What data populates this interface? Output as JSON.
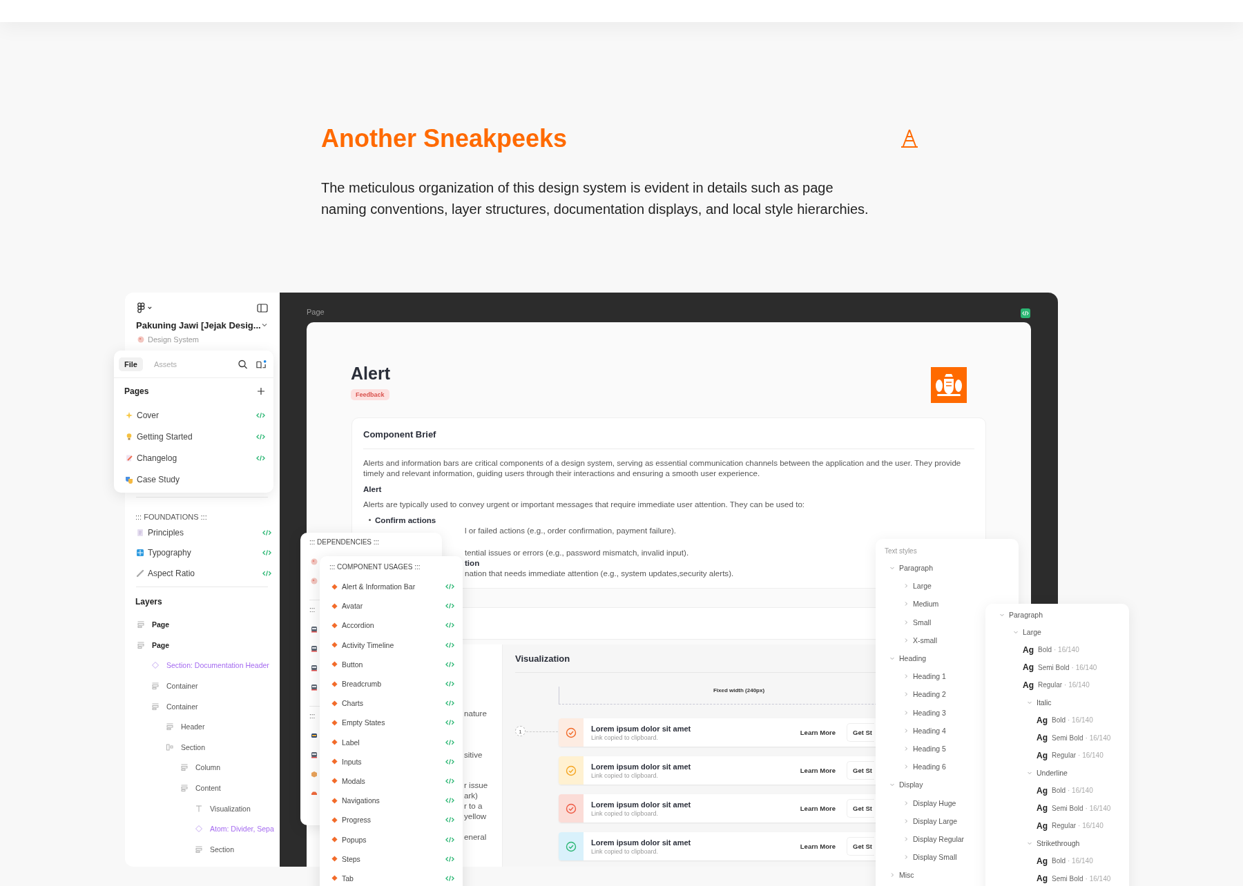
{
  "header": {
    "title": "Another Sneakpeeks",
    "description": "The meticulous organization of this design system is evident in details such as page naming conventions, layer structures, documentation displays, and local style hierarchies."
  },
  "sidebar": {
    "file_name": "Pakuning Jawi [Jejak Desig...",
    "project": "Design System",
    "foundations_title": "::: FOUNDATIONS :::",
    "foundations": [
      {
        "label": "Principles"
      },
      {
        "label": "Typography"
      },
      {
        "label": "Aspect Ratio"
      }
    ],
    "layers_title": "Layers",
    "layers": [
      {
        "label": "Page",
        "kind": "frame"
      },
      {
        "label": "Page",
        "kind": "frame",
        "children": [
          {
            "label": "Section: Documentation Header",
            "kind": "component"
          },
          {
            "label": "Container",
            "kind": "frame"
          },
          {
            "label": "Container",
            "kind": "frame",
            "children": [
              {
                "label": "Header",
                "kind": "frame"
              },
              {
                "label": "Section",
                "kind": "columns",
                "children": [
                  {
                    "label": "Column",
                    "kind": "frame"
                  },
                  {
                    "label": "Content",
                    "kind": "frame",
                    "children": [
                      {
                        "label": "Visualization",
                        "kind": "text"
                      },
                      {
                        "label": "Atom: Divider, Sepa",
                        "kind": "component"
                      },
                      {
                        "label": "Section",
                        "kind": "frame"
                      }
                    ]
                  }
                ]
              }
            ]
          }
        ]
      }
    ]
  },
  "pages_popover": {
    "tabs": [
      {
        "label": "File",
        "selected": true
      },
      {
        "label": "Assets",
        "selected": false
      }
    ],
    "title": "Pages",
    "pages": [
      {
        "label": "Cover",
        "has_code": true
      },
      {
        "label": "Getting Started",
        "has_code": true
      },
      {
        "label": "Changelog",
        "has_code": true
      },
      {
        "label": "Case Study",
        "has_code": false
      }
    ]
  },
  "canvas": {
    "label": "Page"
  },
  "doc": {
    "title": "Alert",
    "tag": "Feedback",
    "brief": {
      "title": "Component Brief",
      "intro": "Alerts and information bars are critical components of a design system, serving as essential communication channels between the application and the user. They provide timely and relevant information, guiding users through their interactions and ensuring a smooth user experience.",
      "heading": "Alert",
      "lead": "Alerts are typically used to convey urgent or important messages that require immediate user attention. They can be used to:",
      "bullet": "Confirm actions",
      "partial_lines": [
        {
          "kind": "text",
          "text": "l or failed actions (e.g., order confirmation, payment failure)."
        },
        {
          "kind": "text",
          "text": "tential issues or errors (e.g., password mismatch, invalid input)."
        },
        {
          "kind": "bold",
          "text": "tion"
        },
        {
          "kind": "text",
          "text": "nation that needs immediate attention (e.g., system updates,security alerts)."
        }
      ]
    },
    "partial_column": [
      [
        "nature"
      ],
      [
        "sitive"
      ],
      [
        "r issue",
        "ark)",
        "r to a",
        "yellow"
      ],
      [
        "eneral"
      ]
    ],
    "visualization": {
      "title": "Visualization",
      "width_note": "Fixed width (240px)",
      "step": "1",
      "alerts": [
        {
          "kind": "success",
          "title": "Lorem ipsum dolor sit amet",
          "subtitle": "Link copied to clipboard.",
          "link": "Learn More",
          "action": "Get St"
        },
        {
          "kind": "warning",
          "title": "Lorem ipsum dolor sit amet",
          "subtitle": "Link copied to clipboard.",
          "link": "Learn More",
          "action": "Get St"
        },
        {
          "kind": "error",
          "title": "Lorem ipsum dolor sit amet",
          "subtitle": "Link copied to clipboard.",
          "link": "Learn More",
          "action": "Get St"
        },
        {
          "kind": "info",
          "title": "Lorem ipsum dolor sit amet",
          "subtitle": "Link copied to clipboard.",
          "link": "Learn More",
          "action": "Get St"
        }
      ]
    }
  },
  "dependencies": {
    "title": "::: DEPENDENCIES :::",
    "section_labels": [
      ":::",
      ":::"
    ]
  },
  "component_usages": {
    "title": "::: COMPONENT USAGES :::",
    "items": [
      "Alert & Information Bar",
      "Avatar",
      "Accordion",
      "Activity Timeline",
      "Button",
      "Breadcrumb",
      "Charts",
      "Empty States",
      "Label",
      "Inputs",
      "Modals",
      "Navigations",
      "Progress",
      "Popups",
      "Steps",
      "Tab"
    ]
  },
  "text_styles": {
    "title": "Text styles",
    "tree": [
      {
        "label": "Paragraph",
        "expanded": true,
        "children": [
          {
            "label": "Large",
            "expanded": false
          },
          {
            "label": "Medium",
            "expanded": false
          },
          {
            "label": "Small",
            "expanded": false
          },
          {
            "label": "X-small",
            "expanded": false
          }
        ]
      },
      {
        "label": "Heading",
        "expanded": true,
        "children": [
          {
            "label": "Heading 1",
            "expanded": false
          },
          {
            "label": "Heading 2",
            "expanded": false
          },
          {
            "label": "Heading 3",
            "expanded": false
          },
          {
            "label": "Heading 4",
            "expanded": false
          },
          {
            "label": "Heading 5",
            "expanded": false
          },
          {
            "label": "Heading 6",
            "expanded": false
          }
        ]
      },
      {
        "label": "Display",
        "expanded": true,
        "children": [
          {
            "label": "Display Huge",
            "expanded": false
          },
          {
            "label": "Display Large",
            "expanded": false
          },
          {
            "label": "Display Regular",
            "expanded": false
          },
          {
            "label": "Display Small",
            "expanded": false
          }
        ]
      },
      {
        "label": "Misc",
        "expanded": false
      }
    ]
  },
  "style_details": {
    "tree": [
      {
        "label": "Paragraph",
        "expanded": true,
        "children": [
          {
            "label": "Large",
            "expanded": true,
            "children": [
              {
                "kind": "style",
                "sample": "Ag",
                "name": "Bold",
                "spec": "· 16/140"
              },
              {
                "kind": "style",
                "sample": "Ag",
                "name": "Semi Bold",
                "spec": "· 16/140"
              },
              {
                "kind": "style",
                "sample": "Ag",
                "name": "Regular",
                "spec": "· 16/140"
              },
              {
                "label": "Italic",
                "expanded": true,
                "children": [
                  {
                    "kind": "style",
                    "sample": "Ag",
                    "name": "Bold",
                    "spec": "· 16/140"
                  },
                  {
                    "kind": "style",
                    "sample": "Ag",
                    "name": "Semi Bold",
                    "spec": "· 16/140"
                  },
                  {
                    "kind": "style",
                    "sample": "Ag",
                    "name": "Regular",
                    "spec": "· 16/140"
                  }
                ]
              },
              {
                "label": "Underline",
                "expanded": true,
                "children": [
                  {
                    "kind": "style",
                    "sample": "Ag",
                    "name": "Bold",
                    "spec": "· 16/140"
                  },
                  {
                    "kind": "style",
                    "sample": "Ag",
                    "name": "Semi Bold",
                    "spec": "· 16/140"
                  },
                  {
                    "kind": "style",
                    "sample": "Ag",
                    "name": "Regular",
                    "spec": "· 16/140"
                  }
                ]
              },
              {
                "label": "Strikethrough",
                "expanded": true,
                "children": [
                  {
                    "kind": "style",
                    "sample": "Ag",
                    "name": "Bold",
                    "spec": "· 16/140"
                  },
                  {
                    "kind": "style",
                    "sample": "Ag",
                    "name": "Semi Bold",
                    "spec": "· 16/140"
                  }
                ]
              }
            ]
          }
        ]
      }
    ]
  }
}
